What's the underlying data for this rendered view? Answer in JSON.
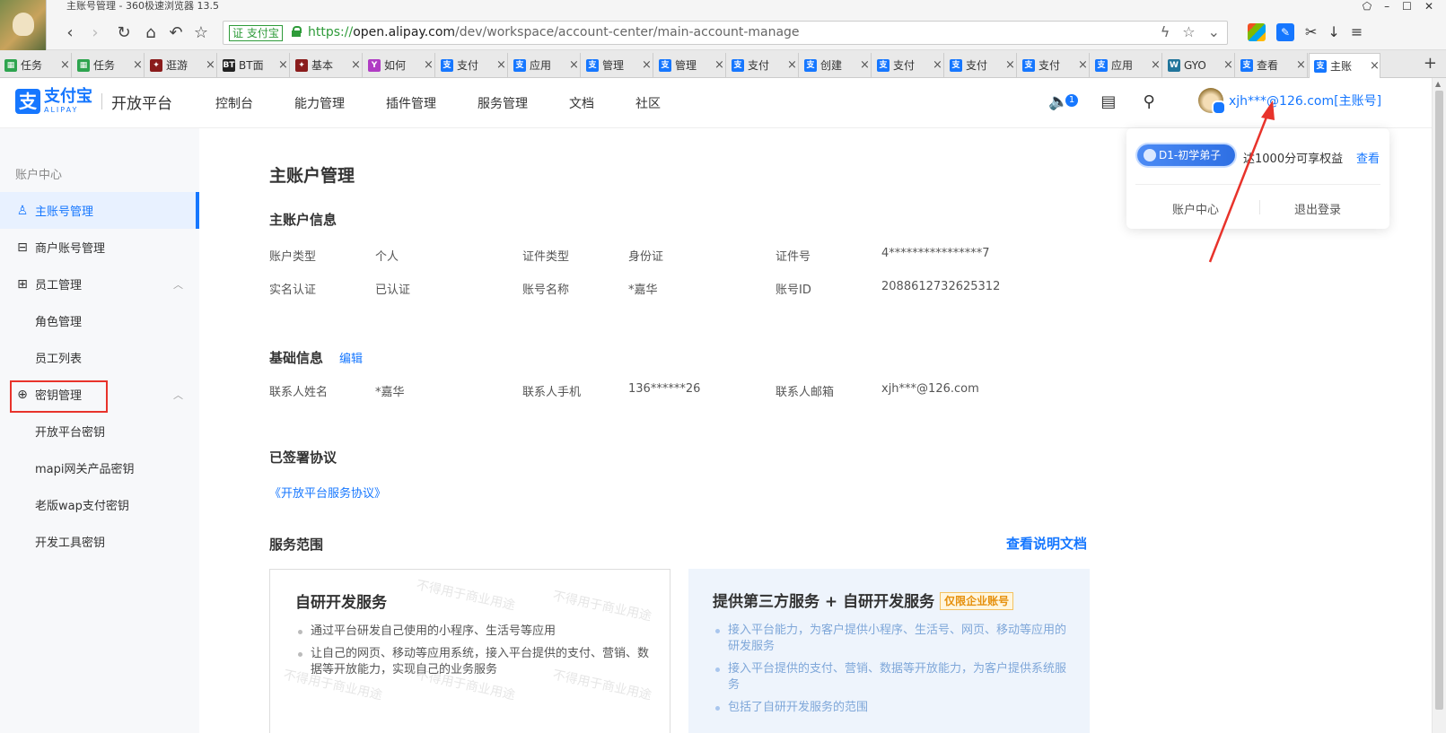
{
  "window": {
    "title": "主账号管理 - 360极速浏览器 13.5",
    "controls": [
      "⬠",
      "–",
      "☐",
      "✕"
    ]
  },
  "address": {
    "cert_label": "证 支付宝",
    "scheme": "https://",
    "host": "open.alipay.com",
    "path": "/dev/workspace/account-center/main-account-manage"
  },
  "tabs": [
    {
      "label": "任务",
      "icon_color": "#2ea44f",
      "icon": "▦"
    },
    {
      "label": "任务",
      "icon_color": "#2ea44f",
      "icon": "▦"
    },
    {
      "label": "逛游",
      "icon_color": "#8a1c1c",
      "icon": "✦"
    },
    {
      "label": "BT面",
      "icon_color": "#222222",
      "icon": "BT"
    },
    {
      "label": "基本",
      "icon_color": "#8a1c1c",
      "icon": "✦"
    },
    {
      "label": "如何",
      "icon_color": "#b03cc4",
      "icon": "Y"
    },
    {
      "label": "支付",
      "icon_color": "#1677ff",
      "icon": "支"
    },
    {
      "label": "应用",
      "icon_color": "#1677ff",
      "icon": "支"
    },
    {
      "label": "管理",
      "icon_color": "#1677ff",
      "icon": "支"
    },
    {
      "label": "管理",
      "icon_color": "#1677ff",
      "icon": "支"
    },
    {
      "label": "支付",
      "icon_color": "#1677ff",
      "icon": "支"
    },
    {
      "label": "创建",
      "icon_color": "#1677ff",
      "icon": "支"
    },
    {
      "label": "支付",
      "icon_color": "#1677ff",
      "icon": "支"
    },
    {
      "label": "支付",
      "icon_color": "#1677ff",
      "icon": "支"
    },
    {
      "label": "支付",
      "icon_color": "#1677ff",
      "icon": "支"
    },
    {
      "label": "应用",
      "icon_color": "#1677ff",
      "icon": "支"
    },
    {
      "label": "GYO",
      "icon_color": "#21759b",
      "icon": "W"
    },
    {
      "label": "查看",
      "icon_color": "#1677ff",
      "icon": "支"
    },
    {
      "label": "主账",
      "icon_color": "#1677ff",
      "icon": "支"
    }
  ],
  "header": {
    "logo_cn": "支付宝",
    "logo_en": "ALIPAY",
    "logo_sub": "开放平台",
    "nav": [
      "控制台",
      "能力管理",
      "插件管理",
      "服务管理",
      "文档",
      "社区"
    ],
    "notif_count": "1",
    "user": "xjh***@126.com[主账号]"
  },
  "sidebar": {
    "title": "账户中心",
    "items": [
      {
        "label": "主账号管理",
        "icon": "♙"
      },
      {
        "label": "商户账号管理",
        "icon": "⊟"
      },
      {
        "label": "员工管理",
        "icon": "⊞"
      },
      {
        "label": "角色管理"
      },
      {
        "label": "员工列表"
      },
      {
        "label": "密钥管理",
        "icon": "⊕"
      },
      {
        "label": "开放平台密钥"
      },
      {
        "label": "mapi网关产品密钥"
      },
      {
        "label": "老版wap支付密钥"
      },
      {
        "label": "开发工具密钥"
      }
    ]
  },
  "main": {
    "page_title": "主账户管理",
    "account_info": {
      "title": "主账户信息",
      "rows": [
        [
          {
            "label": "账户类型",
            "value": "个人"
          },
          {
            "label": "证件类型",
            "value": "身份证"
          },
          {
            "label": "证件号",
            "value": "4****************7"
          }
        ],
        [
          {
            "label": "实名认证",
            "value": "已认证"
          },
          {
            "label": "账号名称",
            "value": "*嘉华"
          },
          {
            "label": "账号ID",
            "value": "2088612732625312"
          }
        ]
      ]
    },
    "basic_info": {
      "title": "基础信息",
      "edit": "编辑",
      "row": [
        {
          "label": "联系人姓名",
          "value": "*嘉华"
        },
        {
          "label": "联系人手机",
          "value": "136******26"
        },
        {
          "label": "联系人邮箱",
          "value": "xjh***@126.com"
        }
      ]
    },
    "signed": {
      "title": "已签署协议",
      "link": "《开放平台服务协议》"
    },
    "service": {
      "title": "服务范围",
      "doc_link": "查看说明文档",
      "card1": {
        "title": "自研开发服务",
        "items": [
          "通过平台研发自己使用的小程序、生活号等应用",
          "让自己的网页、移动等应用系统，接入平台提供的支付、营销、数据等开放能力，实现自己的业务服务"
        ]
      },
      "card2": {
        "title": "提供第三方服务 + 自研开发服务",
        "badge": "仅限企业账号",
        "items": [
          "接入平台能力，为客户提供小程序、生活号、网页、移动等应用的研发服务",
          "接入平台提供的支付、营销、数据等开放能力，为客户提供系统服务",
          "包括了自研开发服务的范围"
        ]
      },
      "watermark": "不得用于商业用途"
    }
  },
  "dropdown": {
    "level": "D1-初学弟子",
    "perk": "达1000分可享权益",
    "perk_link": "查看",
    "account_center": "账户中心",
    "logout": "退出登录"
  },
  "colors": {
    "accent": "#1677ff",
    "annotation": "#e8332b"
  }
}
